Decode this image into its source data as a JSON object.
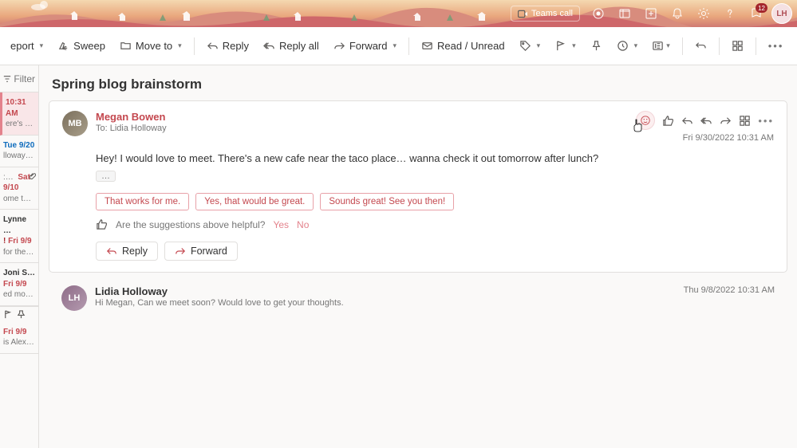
{
  "header": {
    "teams_call": "Teams call",
    "badge": "12",
    "avatar_initials": "LH"
  },
  "toolbar": {
    "report": "eport",
    "sweep": "Sweep",
    "move_to": "Move to",
    "reply": "Reply",
    "reply_all": "Reply all",
    "forward": "Forward",
    "read_unread": "Read / Unread"
  },
  "filter_label": "Filter",
  "list": [
    {
      "time": "10:31 AM",
      "line2": "ere's a …"
    },
    {
      "time": "Tue 9/20",
      "line2": "lloway…"
    },
    {
      "time": "Sat 9/10",
      "pre": ":…",
      "line2": "ome to…",
      "clip": true
    },
    {
      "time": "Lynne …",
      "t2": "Fri 9/9",
      "line2": "for the…",
      "red_marker": true
    },
    {
      "time": "Joni S…",
      "t2": "Fri 9/9",
      "line2": "ed mov…"
    },
    {
      "time": "Fri 9/9",
      "line2": "is Alex I…"
    }
  ],
  "thread": {
    "title": "Spring blog brainstorm",
    "msg": {
      "from": "Megan Bowen",
      "to_label": "To:  Lidia Holloway",
      "date": "Fri 9/30/2022 10:31 AM",
      "body": "Hey! I would love to meet. There's a new cafe near the taco place… wanna check it out tomorrow after lunch?",
      "more": "…",
      "suggestions": [
        "That works for me.",
        "Yes, that would be great.",
        "Sounds great! See you then!"
      ],
      "feedback_q": "Are the suggestions above helpful?",
      "yes": "Yes",
      "no": "No",
      "reply_btn": "Reply",
      "forward_btn": "Forward"
    },
    "prev": {
      "from": "Lidia Holloway",
      "preview": "Hi Megan, Can we meet soon? Would love to get your thoughts.",
      "date": "Thu 9/8/2022 10:31 AM"
    }
  }
}
